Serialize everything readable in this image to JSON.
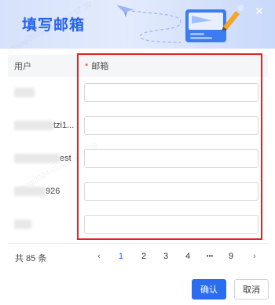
{
  "dialog": {
    "title": "填写邮箱",
    "close_icon": "close-icon"
  },
  "table": {
    "columns": {
      "user": "用户",
      "email_required_mark": "*",
      "email": "邮箱"
    },
    "rows": [
      {
        "user_text": "",
        "email_value": "",
        "email_placeholder": ""
      },
      {
        "user_text": "tzi1...",
        "email_value": "",
        "email_placeholder": ""
      },
      {
        "user_text": "est",
        "email_value": "",
        "email_placeholder": ""
      },
      {
        "user_text": "926",
        "email_value": "",
        "email_placeholder": ""
      },
      {
        "user_text": "",
        "email_value": "",
        "email_placeholder": ""
      }
    ]
  },
  "pagination": {
    "total": "共 85 条",
    "prev_icon": "chevron-left-icon",
    "pages": [
      "1",
      "2",
      "3",
      "4",
      "•••",
      "9"
    ],
    "current": "1",
    "next_icon": "chevron-right-icon"
  },
  "footer": {
    "confirm_label": "确认",
    "cancel_label": "取消"
  },
  "colors": {
    "accent": "#2563eb",
    "highlight_border": "#e02424",
    "header_bg": "#d6e2fb"
  }
}
